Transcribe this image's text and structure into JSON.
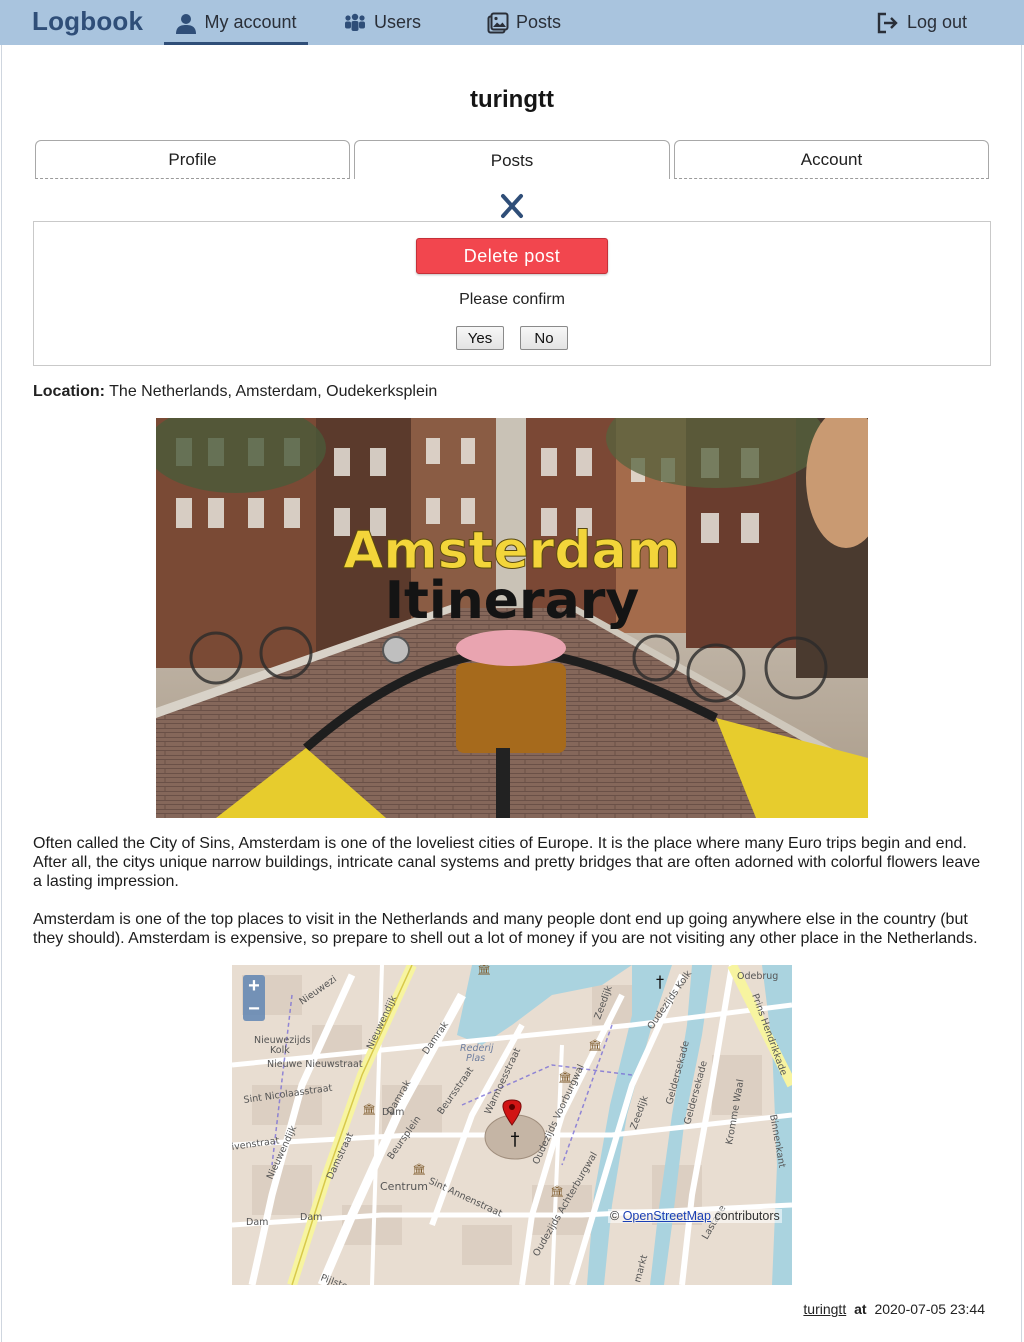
{
  "nav": {
    "brand": "Logbook",
    "my_account": "My account",
    "users": "Users",
    "posts": "Posts",
    "logout": "Log out"
  },
  "profile": {
    "username": "turingtt"
  },
  "tabs": [
    {
      "label": "Profile"
    },
    {
      "label": "Posts"
    },
    {
      "label": "Account"
    }
  ],
  "confirm": {
    "delete_label": "Delete post",
    "prompt": "Please confirm",
    "yes_label": "Yes",
    "no_label": "No"
  },
  "post": {
    "location_label": "Location:",
    "location_value": "The Netherlands, Amsterdam, Oudekerksplein",
    "image_title_line1": "Amsterdam",
    "image_title_line2": "Itinerary",
    "paragraph1": "Often called the City of Sins, Amsterdam is one of the loveliest cities of Europe. It is the place where many Euro trips begin and end. After all, the citys unique narrow buildings, intricate canal systems and pretty bridges that are often adorned with colorful flowers leave a lasting impression.",
    "paragraph2": "Amsterdam is one of the top places to visit in the Netherlands and many people dont end up going anywhere else in the country (but they should). Amsterdam is expensive, so prepare to shell out a lot of money if you are not visiting any other place in the Netherlands.",
    "author": "turingtt",
    "at_label": "at",
    "timestamp": "2020-07-05 23:44"
  },
  "map": {
    "zoom_in": "+",
    "zoom_out": "−",
    "attribution_prefix": "©",
    "attribution_link": "OpenStreetMap",
    "attribution_suffix": "contributors",
    "labels": {
      "nieuwezijds": "Nieuwezijds",
      "kolk": "Kolk",
      "nieuwe_nieuwstraat": "Nieuwe Nieuwstraat",
      "sint_nicolaasstraat": "Sint Nicolaasstraat",
      "damrak": "Damrak",
      "damrak2": "Damrak",
      "dam": "Dam",
      "dam2": "Dam",
      "dam3": "Dam",
      "beursstraat": "Beursstraat",
      "beursplein": "Beursplein",
      "warmoesstraat": "Warmoesstraat",
      "oudezijds_voorburgwal": "Oudezijds Voorburgwal",
      "oudezijds_achterburgwal": "Oudezijds Achterburgwal",
      "sint_annenstraat": "Sint Annenstraat",
      "centrum": "Centrum",
      "zeedijk": "Zeedijk",
      "zeedijk2": "Zeedijk",
      "oudezijds_kolk": "Oudezijds Kolk",
      "odebrug": "Odebrug",
      "prins_hendrikkade": "Prins Hendrikkade",
      "geldersekade": "Geldersekade",
      "geldersekade2": "Geldersekade",
      "kromme_waal": "Kromme Waal",
      "binnenkant": "Binnenkant",
      "rederij": "Rederij",
      "plas": "Plas",
      "nieuwendijk": "Nieuwendijk",
      "nieuwendijk2": "Nieuwendijk",
      "nieuwezijds_short": "Nieuwezi",
      "ivenstraat": "ivenstraat",
      "pijlsteeg": "Pijlsteeg",
      "damstraat": "Damstraat",
      "lastage": "Lastage",
      "markt": "markt"
    }
  },
  "colors": {
    "navbar": "#a9c4de",
    "brand": "#2f4e78",
    "delete": "#f2464e"
  }
}
